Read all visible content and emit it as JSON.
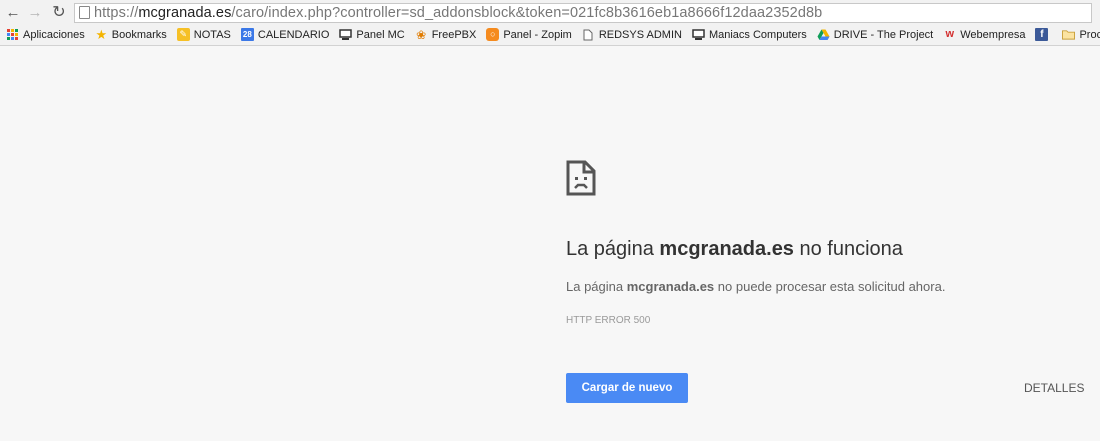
{
  "browser": {
    "url_scheme": "https://",
    "url_host": "mcgranada.es",
    "url_path": "/caro/index.php?controller=sd_addonsblock&token=021fc8b3616eb1a8666f12daa2352d8b"
  },
  "bookmarks": [
    {
      "label": "Aplicaciones",
      "icon": "apps-grid-icon"
    },
    {
      "label": "Bookmarks",
      "icon": "star-icon",
      "color": "#f4b400"
    },
    {
      "label": "NOTAS",
      "icon": "notes-icon",
      "color": "#f6c026"
    },
    {
      "label": "CALENDARIO",
      "icon": "calendar-icon",
      "color": "#3b78e7",
      "badge": "28"
    },
    {
      "label": "Panel MC",
      "icon": "monitor-icon"
    },
    {
      "label": "FreePBX",
      "icon": "freepbx-icon"
    },
    {
      "label": "Panel - Zopim",
      "icon": "zopim-icon",
      "color": "#f58b1f"
    },
    {
      "label": "REDSYS ADMIN",
      "icon": "page-icon"
    },
    {
      "label": "Maniacs Computers",
      "icon": "monitor-icon"
    },
    {
      "label": "DRIVE - The Project",
      "icon": "drive-icon"
    },
    {
      "label": "Webempresa",
      "icon": "webempresa-icon",
      "color": "#d32f2f"
    },
    {
      "label": "",
      "icon": "facebook-icon",
      "color": "#3b5998"
    },
    {
      "label": "Procesing... !",
      "icon": "folder-icon",
      "color": "#e0b34b"
    }
  ],
  "error": {
    "title_prefix": "La página ",
    "title_host": "mcgranada.es",
    "title_suffix": " no funciona",
    "desc_prefix": "La página ",
    "desc_host": "mcgranada.es",
    "desc_suffix": " no puede procesar esta solicitud ahora.",
    "code": "HTTP ERROR 500",
    "reload_label": "Cargar de nuevo",
    "details_label": "DETALLES"
  },
  "colors": {
    "primary_button": "#4a8af4",
    "background": "#f7f7f7"
  }
}
